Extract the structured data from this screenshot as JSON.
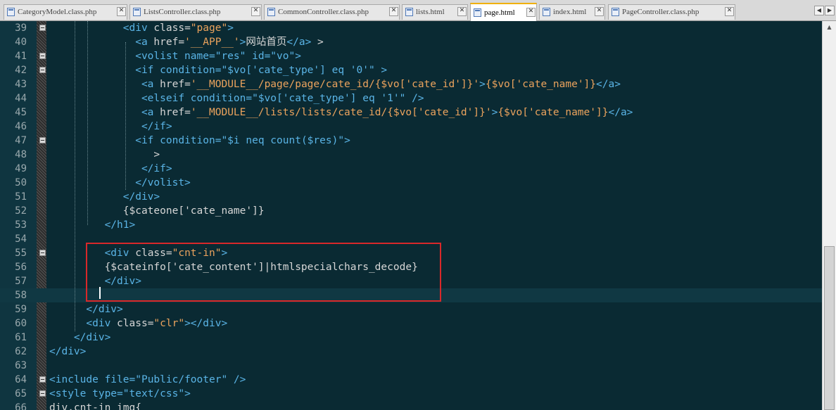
{
  "tabs": [
    {
      "label": "CategoryModel.class.php",
      "close": "✕"
    },
    {
      "label": "ListsController.class.php",
      "close": "✕"
    },
    {
      "label": "CommonController.class.php",
      "close": "✕"
    },
    {
      "label": "lists.html",
      "close": "✕"
    },
    {
      "label": "page.html",
      "close": "✕"
    },
    {
      "label": "index.html",
      "close": "✕"
    },
    {
      "label": "PageController.class.php",
      "close": "✕"
    }
  ],
  "nav": {
    "prev": "◀",
    "next": "▶"
  },
  "scroll_up": "▲",
  "colors": {
    "bg": "#0a2a33",
    "tag": "#5ab4e6",
    "attr": "#d6d6d6",
    "string": "#eba35d",
    "text": "#d6d6d6",
    "highlight_box": "#d8282a",
    "active_tab_accent": "#f0b000"
  },
  "lines": [
    {
      "n": "39",
      "segs": [
        [
          "            ",
          "t"
        ],
        [
          "<div",
          "g"
        ],
        [
          " class=",
          "a"
        ],
        [
          "\"page\"",
          "s"
        ],
        [
          ">",
          "g"
        ]
      ]
    },
    {
      "n": "40",
      "segs": [
        [
          "              ",
          "t"
        ],
        [
          "<a",
          "g"
        ],
        [
          " href=",
          "a"
        ],
        [
          "'__APP__'",
          "s"
        ],
        [
          ">",
          "g"
        ],
        [
          "网站首页",
          "t"
        ],
        [
          "</a>",
          "g"
        ],
        [
          " >",
          "t"
        ]
      ]
    },
    {
      "n": "41",
      "segs": [
        [
          "              ",
          "t"
        ],
        [
          "<volist",
          "o"
        ],
        [
          " name=",
          "o"
        ],
        [
          "\"res\"",
          "o"
        ],
        [
          " id=",
          "o"
        ],
        [
          "\"vo\"",
          "o"
        ],
        [
          ">",
          "o"
        ]
      ]
    },
    {
      "n": "42",
      "segs": [
        [
          "              ",
          "t"
        ],
        [
          "<if",
          "o"
        ],
        [
          " condition=",
          "o"
        ],
        [
          "\"$vo['cate_type'] eq '0'\"",
          "o"
        ],
        [
          " >",
          "o"
        ]
      ]
    },
    {
      "n": "43",
      "segs": [
        [
          "               ",
          "t"
        ],
        [
          "<a",
          "g"
        ],
        [
          " href=",
          "a"
        ],
        [
          "'__MODULE__/page/page/cate_id/{$vo['",
          "s"
        ],
        [
          "cate_id",
          "s"
        ],
        [
          "']}'",
          "s"
        ],
        [
          ">",
          "g"
        ],
        [
          "{$vo['",
          "s"
        ],
        [
          "cate_name",
          "s"
        ],
        [
          "']}",
          "s"
        ],
        [
          "</a>",
          "g"
        ]
      ]
    },
    {
      "n": "44",
      "segs": [
        [
          "               ",
          "t"
        ],
        [
          "<elseif",
          "o"
        ],
        [
          " condition=",
          "o"
        ],
        [
          "\"$vo['cate_type'] eq '1'\"",
          "o"
        ],
        [
          " />",
          "o"
        ]
      ]
    },
    {
      "n": "45",
      "segs": [
        [
          "               ",
          "t"
        ],
        [
          "<a",
          "g"
        ],
        [
          " href=",
          "a"
        ],
        [
          "'__MODULE__/lists/lists/cate_id/{$vo['",
          "s"
        ],
        [
          "cate_id",
          "s"
        ],
        [
          "']}'",
          "s"
        ],
        [
          ">",
          "g"
        ],
        [
          "{$vo['",
          "s"
        ],
        [
          "cate_name",
          "s"
        ],
        [
          "']}",
          "s"
        ],
        [
          "</a>",
          "g"
        ]
      ]
    },
    {
      "n": "46",
      "segs": [
        [
          "               ",
          "t"
        ],
        [
          "</if>",
          "o"
        ]
      ]
    },
    {
      "n": "47",
      "segs": [
        [
          "              ",
          "t"
        ],
        [
          "<if",
          "o"
        ],
        [
          " condition=",
          "o"
        ],
        [
          "\"$i neq count($res)\"",
          "o"
        ],
        [
          ">",
          "o"
        ]
      ]
    },
    {
      "n": "48",
      "segs": [
        [
          "                 ",
          "t"
        ],
        [
          ">",
          "t"
        ]
      ]
    },
    {
      "n": "49",
      "segs": [
        [
          "               ",
          "t"
        ],
        [
          "</if>",
          "o"
        ]
      ]
    },
    {
      "n": "50",
      "segs": [
        [
          "              ",
          "t"
        ],
        [
          "</volist>",
          "o"
        ]
      ]
    },
    {
      "n": "51",
      "segs": [
        [
          "            ",
          "t"
        ],
        [
          "</div>",
          "g"
        ]
      ]
    },
    {
      "n": "52",
      "segs": [
        [
          "            ",
          "t"
        ],
        [
          "{$cateone['cate_name']}",
          "t"
        ]
      ]
    },
    {
      "n": "53",
      "segs": [
        [
          "         ",
          "t"
        ],
        [
          "</h1>",
          "g"
        ]
      ]
    },
    {
      "n": "54",
      "segs": [
        [
          "",
          "t"
        ]
      ]
    },
    {
      "n": "55",
      "segs": [
        [
          "         ",
          "t"
        ],
        [
          "<div",
          "g"
        ],
        [
          " class=",
          "a"
        ],
        [
          "\"cnt-in\"",
          "s"
        ],
        [
          ">",
          "g"
        ]
      ]
    },
    {
      "n": "56",
      "segs": [
        [
          "         ",
          "t"
        ],
        [
          "{$cateinfo['cate_content']|htmlspecialchars_decode}",
          "t"
        ]
      ]
    },
    {
      "n": "57",
      "segs": [
        [
          "         ",
          "t"
        ],
        [
          "</div>",
          "g"
        ]
      ]
    },
    {
      "n": "58",
      "segs": [
        [
          "",
          "t"
        ]
      ]
    },
    {
      "n": "59",
      "segs": [
        [
          "      ",
          "t"
        ],
        [
          "</div>",
          "g"
        ]
      ]
    },
    {
      "n": "60",
      "segs": [
        [
          "      ",
          "t"
        ],
        [
          "<div",
          "g"
        ],
        [
          " class=",
          "a"
        ],
        [
          "\"clr\"",
          "s"
        ],
        [
          "></div>",
          "g"
        ]
      ]
    },
    {
      "n": "61",
      "segs": [
        [
          "    ",
          "t"
        ],
        [
          "</div>",
          "g"
        ]
      ]
    },
    {
      "n": "62",
      "segs": [
        [
          "",
          "t"
        ],
        [
          "</div>",
          "g"
        ]
      ]
    },
    {
      "n": "63",
      "segs": [
        [
          "",
          "t"
        ]
      ]
    },
    {
      "n": "64",
      "segs": [
        [
          "",
          "t"
        ],
        [
          "<include",
          "o"
        ],
        [
          " file=",
          "o"
        ],
        [
          "\"Public/footer\"",
          "o"
        ],
        [
          " />",
          "o"
        ]
      ]
    },
    {
      "n": "65",
      "segs": [
        [
          "",
          "t"
        ],
        [
          "<style",
          "o"
        ],
        [
          " type=",
          "o"
        ],
        [
          "\"text/css\"",
          "o"
        ],
        [
          ">",
          "o"
        ]
      ]
    },
    {
      "n": "66",
      "segs": [
        [
          "",
          "t"
        ],
        [
          "div.cnt-in img{",
          "t"
        ]
      ]
    }
  ]
}
